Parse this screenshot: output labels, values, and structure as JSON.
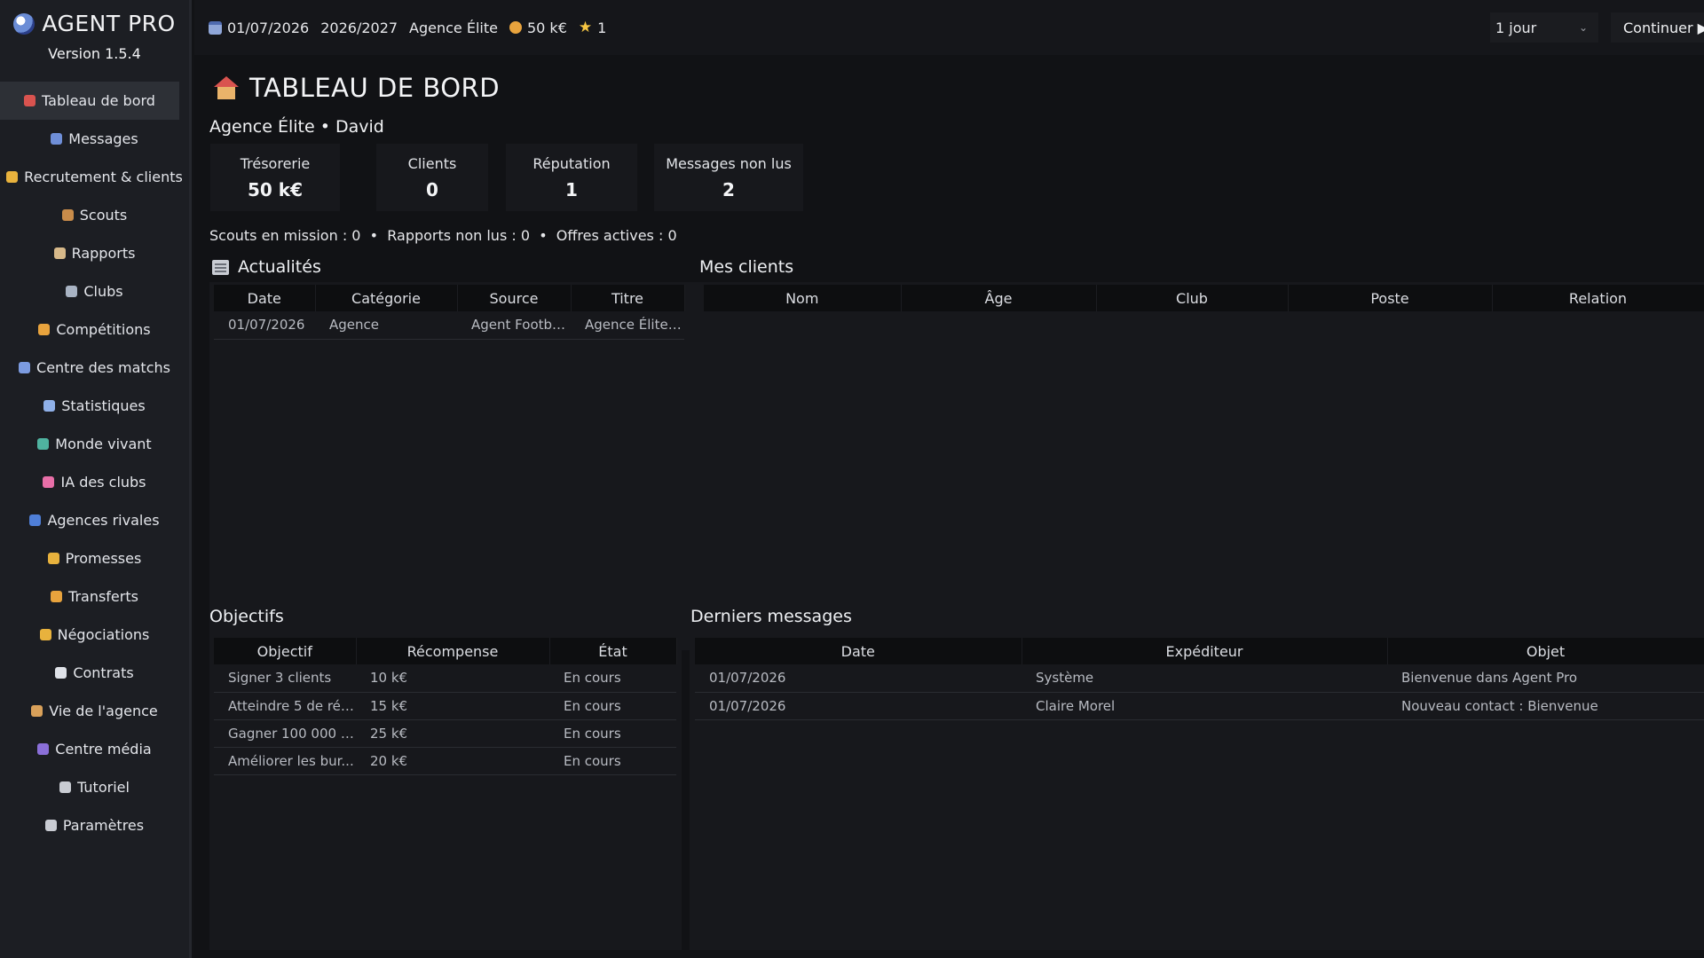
{
  "app": {
    "title": "AGENT PRO",
    "version": "Version 1.5.4"
  },
  "sidebar": {
    "items": [
      {
        "label": "Tableau de bord",
        "icon": "house-icon",
        "color": "#d9534f",
        "active": true
      },
      {
        "label": "Messages",
        "icon": "mail-icon",
        "color": "#6f8fd8"
      },
      {
        "label": "Recrutement & clients",
        "icon": "handshake-icon",
        "color": "#e8b23d"
      },
      {
        "label": "Scouts",
        "icon": "detective-icon",
        "color": "#c98c4a"
      },
      {
        "label": "Rapports",
        "icon": "clipboard-icon",
        "color": "#d7b98a"
      },
      {
        "label": "Clubs",
        "icon": "stadium-icon",
        "color": "#a9b4c4"
      },
      {
        "label": "Compétitions",
        "icon": "trophy-icon",
        "color": "#e8a33d"
      },
      {
        "label": "Centre des matchs",
        "icon": "soccer-ball-icon",
        "color": "#7c9be0"
      },
      {
        "label": "Statistiques",
        "icon": "bar-chart-icon",
        "color": "#8fb0e8"
      },
      {
        "label": "Monde vivant",
        "icon": "globe-icon",
        "color": "#4fb3a0"
      },
      {
        "label": "IA des clubs",
        "icon": "brain-icon",
        "color": "#e86fa8"
      },
      {
        "label": "Agences rivales",
        "icon": "building-icon",
        "color": "#4f7fd8"
      },
      {
        "label": "Promesses",
        "icon": "handshake-icon",
        "color": "#e8b23d"
      },
      {
        "label": "Transferts",
        "icon": "money-bag-icon",
        "color": "#e8a33d"
      },
      {
        "label": "Négociations",
        "icon": "handshake-icon",
        "color": "#e8b23d"
      },
      {
        "label": "Contrats",
        "icon": "document-icon",
        "color": "#dfe2e8"
      },
      {
        "label": "Vie de l'agence",
        "icon": "person-icon",
        "color": "#d9a15a"
      },
      {
        "label": "Centre média",
        "icon": "media-icon",
        "color": "#8a6fd8"
      },
      {
        "label": "Tutoriel",
        "icon": "pointer-icon",
        "color": "#c9ccd3"
      },
      {
        "label": "Paramètres",
        "icon": "gear-icon",
        "color": "#c9ccd3"
      }
    ]
  },
  "topbar": {
    "date": "01/07/2026",
    "season": "2026/2027",
    "agency": "Agence Élite",
    "money": "50 k€",
    "stars": "1",
    "speed": "1 jour",
    "continue_label": "Continuer ▶"
  },
  "dashboard": {
    "title": "TABLEAU DE BORD",
    "agency_line": "Agence Élite • David",
    "stats": [
      {
        "label": "Trésorerie",
        "value": "50 k€"
      },
      {
        "label": "Clients",
        "value": "0"
      },
      {
        "label": "Réputation",
        "value": "1"
      },
      {
        "label": "Messages non lus",
        "value": "2"
      }
    ],
    "summary": "Scouts en mission : 0  •  Rapports non lus : 0  •  Offres actives : 0"
  },
  "news": {
    "title": "Actualités",
    "columns": [
      "Date",
      "Catégorie",
      "Source",
      "Titre"
    ],
    "rows": [
      [
        "01/07/2026",
        "Agence",
        "Agent Football ...",
        "Agence Élite ..."
      ]
    ]
  },
  "clients": {
    "title": "Mes clients",
    "columns": [
      "Nom",
      "Âge",
      "Club",
      "Poste",
      "Relation"
    ],
    "rows": []
  },
  "objectives": {
    "title": "Objectifs",
    "columns": [
      "Objectif",
      "Récompense",
      "État"
    ],
    "rows": [
      [
        "Signer 3 clients",
        "10 k€",
        "En cours"
      ],
      [
        "Atteindre 5 de rép...",
        "15 k€",
        "En cours"
      ],
      [
        "Gagner 100 000 € ...",
        "25 k€",
        "En cours"
      ],
      [
        "Améliorer les bur...",
        "20 k€",
        "En cours"
      ]
    ]
  },
  "messages": {
    "title": "Derniers messages",
    "columns": [
      "Date",
      "Expéditeur",
      "Objet"
    ],
    "rows": [
      [
        "01/07/2026",
        "Système",
        "Bienvenue dans Agent Pro"
      ],
      [
        "01/07/2026",
        "Claire Morel",
        "Nouveau contact : Bienvenue"
      ]
    ]
  }
}
